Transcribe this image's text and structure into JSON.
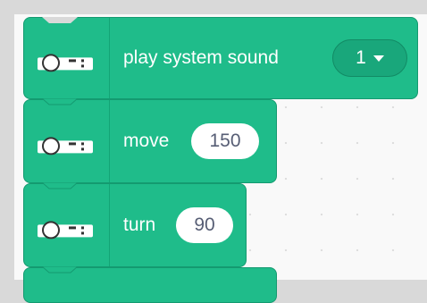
{
  "blocks": [
    {
      "label": "play system sound",
      "value": "1",
      "has_dropdown": true,
      "icon": "robot-icon"
    },
    {
      "label": "move",
      "value": "150",
      "has_dropdown": false,
      "icon": "robot-icon"
    },
    {
      "label": "turn",
      "value": "90",
      "has_dropdown": false,
      "icon": "robot-icon"
    },
    {
      "label": "",
      "value": "",
      "has_dropdown": false,
      "icon": "robot-icon"
    }
  ],
  "colors": {
    "block_fill": "#1fbc8a",
    "block_border": "#149a70",
    "canvas": "#f9f9f9",
    "frame": "#d9d9d9"
  }
}
